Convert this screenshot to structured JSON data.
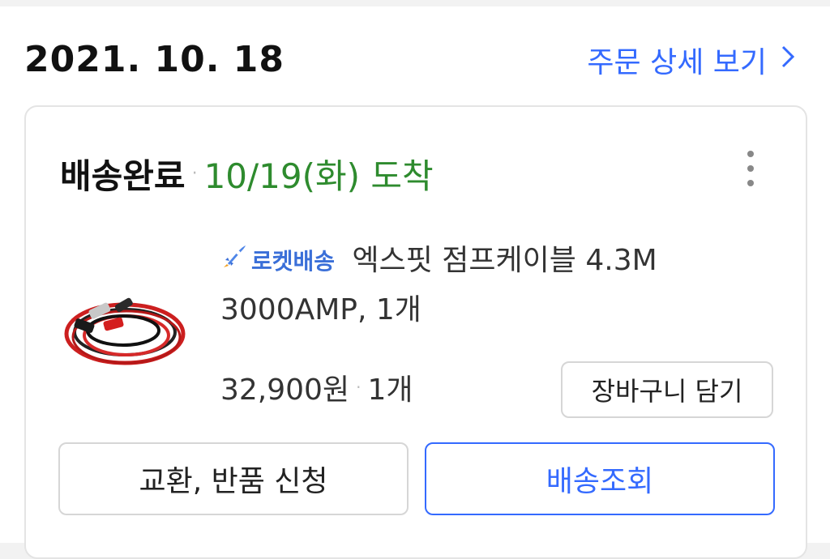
{
  "order": {
    "date": "2021. 10. 18",
    "detail_link": "주문 상세 보기",
    "chevron": "chevron-right-icon"
  },
  "shipment": {
    "status": "배송완료",
    "arrival": "10/19(화) 도착",
    "arrival_color": "#2e8b2e"
  },
  "product": {
    "badge": "로켓배송",
    "title_line1": "엑스핏 점프케이블 4.3M",
    "title_line2": "3000AMP, 1개",
    "price": "32,900원",
    "quantity": "1개",
    "image": "jump-cable-image"
  },
  "actions": {
    "add_to_cart": "장바구니 담기",
    "exchange_return": "교환, 반품 신청",
    "track_delivery": "배송조회"
  },
  "colors": {
    "accent": "#346aff",
    "status_green": "#2e8b2e"
  }
}
